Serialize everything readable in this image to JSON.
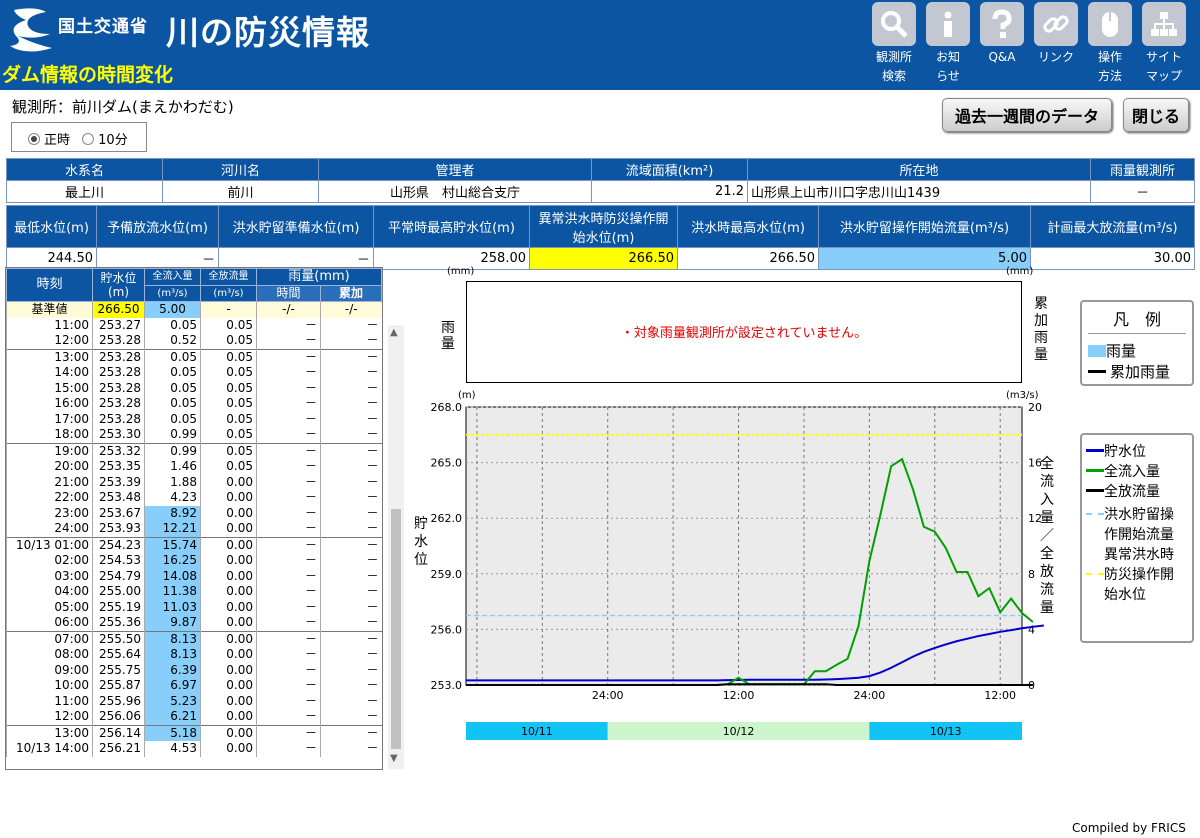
{
  "header": {
    "site_sub": "国土交通省",
    "site_name": "川の防災情報",
    "page_title": "ダム情報の時間変化",
    "nav": [
      {
        "l1": "観測所",
        "l2": "検索",
        "icon": "search-icon"
      },
      {
        "l1": "お知",
        "l2": "らせ",
        "icon": "info-icon"
      },
      {
        "l1": "Q&A",
        "l2": "",
        "icon": "help-icon"
      },
      {
        "l1": "リンク",
        "l2": "",
        "icon": "link-icon"
      },
      {
        "l1": "操作",
        "l2": "方法",
        "icon": "mouse-icon"
      },
      {
        "l1": "サイト",
        "l2": "マップ",
        "icon": "sitemap-icon"
      }
    ]
  },
  "observation": "観測所：前川ダム(まえかわだむ)",
  "buttons": {
    "past_week": "過去一週間のデータ",
    "close": "閉じる"
  },
  "interval": {
    "option1": "正時",
    "option2": "10分",
    "selected": "正時"
  },
  "info1": {
    "headers": [
      "水系名",
      "河川名",
      "管理者",
      "流域面積(km²)",
      "所在地",
      "雨量観測所"
    ],
    "values": [
      "最上川",
      "前川",
      "山形県　村山総合支庁",
      "21.2",
      "山形県上山市川口字忠川山1439",
      "－"
    ]
  },
  "info2": {
    "headers": [
      "最低水位(m)",
      "予備放流水位(m)",
      "洪水貯留準備水位(m)",
      "平常時最高貯水位(m)",
      "異常洪水時防災操作開始水位(m)",
      "洪水時最高水位(m)",
      "洪水貯留操作開始流量(m³/s)",
      "計画最大放流量(m³/s)"
    ],
    "values": [
      "244.50",
      "－",
      "－",
      "258.00",
      "266.50",
      "266.50",
      "5.00",
      "30.00"
    ]
  },
  "table": {
    "h_time": "時刻",
    "h_level": "貯水位(m)",
    "h_inflow": "全流入量",
    "h_outflow": "全放流量",
    "h_unit": "(m³/s)",
    "h_rain": "雨量(mm)",
    "h_hour": "時間",
    "h_cum": "累加",
    "base_label": "基準値",
    "base": [
      "266.50",
      "5.00",
      "-",
      "-/-",
      "-/-"
    ],
    "rows": [
      [
        "11:00",
        "253.27",
        "0.05",
        "0.05",
        "－",
        "－"
      ],
      [
        "12:00",
        "253.28",
        "0.52",
        "0.05",
        "－",
        "－"
      ],
      [
        "13:00",
        "253.28",
        "0.05",
        "0.05",
        "－",
        "－"
      ],
      [
        "14:00",
        "253.28",
        "0.05",
        "0.05",
        "－",
        "－"
      ],
      [
        "15:00",
        "253.28",
        "0.05",
        "0.05",
        "－",
        "－"
      ],
      [
        "16:00",
        "253.28",
        "0.05",
        "0.05",
        "－",
        "－"
      ],
      [
        "17:00",
        "253.28",
        "0.05",
        "0.05",
        "－",
        "－"
      ],
      [
        "18:00",
        "253.30",
        "0.99",
        "0.05",
        "－",
        "－"
      ],
      [
        "19:00",
        "253.32",
        "0.99",
        "0.05",
        "－",
        "－"
      ],
      [
        "20:00",
        "253.35",
        "1.46",
        "0.05",
        "－",
        "－"
      ],
      [
        "21:00",
        "253.39",
        "1.88",
        "0.00",
        "－",
        "－"
      ],
      [
        "22:00",
        "253.48",
        "4.23",
        "0.00",
        "－",
        "－"
      ],
      [
        "23:00",
        "253.67",
        "8.92",
        "0.00",
        "－",
        "－"
      ],
      [
        "24:00",
        "253.93",
        "12.21",
        "0.00",
        "－",
        "－"
      ],
      [
        "10/13 01:00",
        "254.23",
        "15.74",
        "0.00",
        "－",
        "－"
      ],
      [
        "02:00",
        "254.53",
        "16.25",
        "0.00",
        "－",
        "－"
      ],
      [
        "03:00",
        "254.79",
        "14.08",
        "0.00",
        "－",
        "－"
      ],
      [
        "04:00",
        "255.00",
        "11.38",
        "0.00",
        "－",
        "－"
      ],
      [
        "05:00",
        "255.19",
        "11.03",
        "0.00",
        "－",
        "－"
      ],
      [
        "06:00",
        "255.36",
        "9.87",
        "0.00",
        "－",
        "－"
      ],
      [
        "07:00",
        "255.50",
        "8.13",
        "0.00",
        "－",
        "－"
      ],
      [
        "08:00",
        "255.64",
        "8.13",
        "0.00",
        "－",
        "－"
      ],
      [
        "09:00",
        "255.75",
        "6.39",
        "0.00",
        "－",
        "－"
      ],
      [
        "10:00",
        "255.87",
        "6.97",
        "0.00",
        "－",
        "－"
      ],
      [
        "11:00",
        "255.96",
        "5.23",
        "0.00",
        "－",
        "－"
      ],
      [
        "12:00",
        "256.06",
        "6.21",
        "0.00",
        "－",
        "－"
      ],
      [
        "13:00",
        "256.14",
        "5.18",
        "0.00",
        "－",
        "－"
      ],
      [
        "10/13 14:00",
        "256.21",
        "4.53",
        "0.00",
        "－",
        "－"
      ]
    ]
  },
  "rain_chart": {
    "left_unit": "(mm)",
    "right_unit": "(mm)",
    "left_label": "雨量",
    "right_label": "累加雨量",
    "message": "・対象雨量観測所が設定されていません。"
  },
  "chart_data": {
    "type": "line",
    "left_unit": "(m)",
    "right_unit": "(m3/s)",
    "ylabel": "貯水位",
    "y2label": "全流入量／全放流量",
    "ylim": [
      253.0,
      268.0
    ],
    "yticks": [
      "253.0",
      "256.0",
      "259.0",
      "262.0",
      "265.0",
      "268.0"
    ],
    "y2lim": [
      0,
      20
    ],
    "y2ticks": [
      "0",
      "4",
      "8",
      "12",
      "16",
      "20"
    ],
    "xlim": [
      "10/11 11:00",
      "10/13 14:00"
    ],
    "xtick_labels": [
      "24:00",
      "12:00",
      "24:00",
      "12:00"
    ],
    "xticks": [
      "10/12 00:00",
      "10/12 12:00",
      "10/13 00:00",
      "10/13 12:00"
    ],
    "date_bands": [
      "10/11",
      "10/12",
      "10/13"
    ],
    "thresholds": {
      "flood_storage_inflow": 5.0,
      "abnormal_flood_level": 266.5
    },
    "x": [
      "10/11 11:00",
      "10/11 12:00",
      "10/11 13:00",
      "10/11 14:00",
      "10/11 15:00",
      "10/11 16:00",
      "10/11 17:00",
      "10/11 18:00",
      "10/11 19:00",
      "10/11 20:00",
      "10/11 21:00",
      "10/11 22:00",
      "10/11 23:00",
      "10/12 00:00",
      "10/12 01:00",
      "10/12 02:00",
      "10/12 03:00",
      "10/12 04:00",
      "10/12 05:00",
      "10/12 06:00",
      "10/12 07:00",
      "10/12 08:00",
      "10/12 09:00",
      "10/12 10:00",
      "10/12 11:00",
      "10/12 12:00",
      "10/12 13:00",
      "10/12 14:00",
      "10/12 15:00",
      "10/12 16:00",
      "10/12 17:00",
      "10/12 18:00",
      "10/12 19:00",
      "10/12 20:00",
      "10/12 21:00",
      "10/12 22:00",
      "10/12 23:00",
      "10/13 00:00",
      "10/13 01:00",
      "10/13 02:00",
      "10/13 03:00",
      "10/13 04:00",
      "10/13 05:00",
      "10/13 06:00",
      "10/13 07:00",
      "10/13 08:00",
      "10/13 09:00",
      "10/13 10:00",
      "10/13 11:00",
      "10/13 12:00",
      "10/13 13:00",
      "10/13 14:00"
    ],
    "series": [
      {
        "name": "貯水位",
        "axis": "left",
        "color": "#0000cc",
        "values": [
          253.25,
          253.25,
          253.25,
          253.25,
          253.25,
          253.25,
          253.25,
          253.25,
          253.25,
          253.25,
          253.25,
          253.25,
          253.25,
          253.25,
          253.25,
          253.25,
          253.25,
          253.25,
          253.25,
          253.25,
          253.25,
          253.25,
          253.25,
          253.25,
          253.26,
          253.27,
          253.28,
          253.28,
          253.28,
          253.28,
          253.28,
          253.28,
          253.28,
          253.3,
          253.32,
          253.35,
          253.39,
          253.48,
          253.67,
          253.93,
          254.23,
          254.53,
          254.79,
          255.0,
          255.19,
          255.36,
          255.5,
          255.64,
          255.75,
          255.87,
          255.96,
          256.06,
          256.14,
          256.21
        ]
      },
      {
        "name": "全流入量",
        "axis": "right",
        "color": "#00a000",
        "values": [
          0,
          0,
          0,
          0,
          0,
          0,
          0,
          0,
          0,
          0,
          0,
          0,
          0,
          0,
          0,
          0,
          0,
          0,
          0,
          0,
          0,
          0,
          0,
          0,
          0.05,
          0.52,
          0.05,
          0.05,
          0.05,
          0.05,
          0.05,
          0.05,
          0.99,
          0.99,
          1.46,
          1.88,
          4.23,
          8.92,
          12.21,
          15.74,
          16.25,
          14.08,
          11.38,
          11.03,
          9.87,
          8.13,
          8.13,
          6.39,
          6.97,
          5.23,
          6.21,
          5.18,
          4.53
        ]
      },
      {
        "name": "全放流量",
        "axis": "right",
        "color": "#000000",
        "values": [
          0,
          0,
          0,
          0,
          0,
          0,
          0,
          0,
          0,
          0,
          0,
          0,
          0,
          0,
          0,
          0,
          0,
          0,
          0,
          0,
          0,
          0,
          0,
          0,
          0.05,
          0.05,
          0.05,
          0.05,
          0.05,
          0.05,
          0.05,
          0.05,
          0.05,
          0.05,
          0.0,
          0.0,
          0.0,
          0.0,
          0.0,
          0.0,
          0.0,
          0.0,
          0.0,
          0.0,
          0.0,
          0.0,
          0.0,
          0.0,
          0.0,
          0.0,
          0.0,
          0.0,
          0.0
        ]
      }
    ]
  },
  "legend1": {
    "title": "凡　例",
    "rain": "雨量",
    "cum": "累加雨量",
    "rain_color": "#87cefa",
    "cum_color": "#000000"
  },
  "legend2": {
    "level": "貯水位",
    "inflow": "全流入量",
    "outflow": "全放流量",
    "flood_storage_1": "洪水貯留操",
    "flood_storage_2": "作開始流量",
    "abnormal_1": "異常洪水時",
    "abnormal_2": "防災操作開",
    "abnormal_3": "始水位",
    "level_color": "#0000cc",
    "inflow_color": "#00a000",
    "outflow_color": "#000000",
    "flood_color": "#87cefa",
    "abnormal_color": "#ffff00"
  },
  "footer": "Compiled by FRICS"
}
